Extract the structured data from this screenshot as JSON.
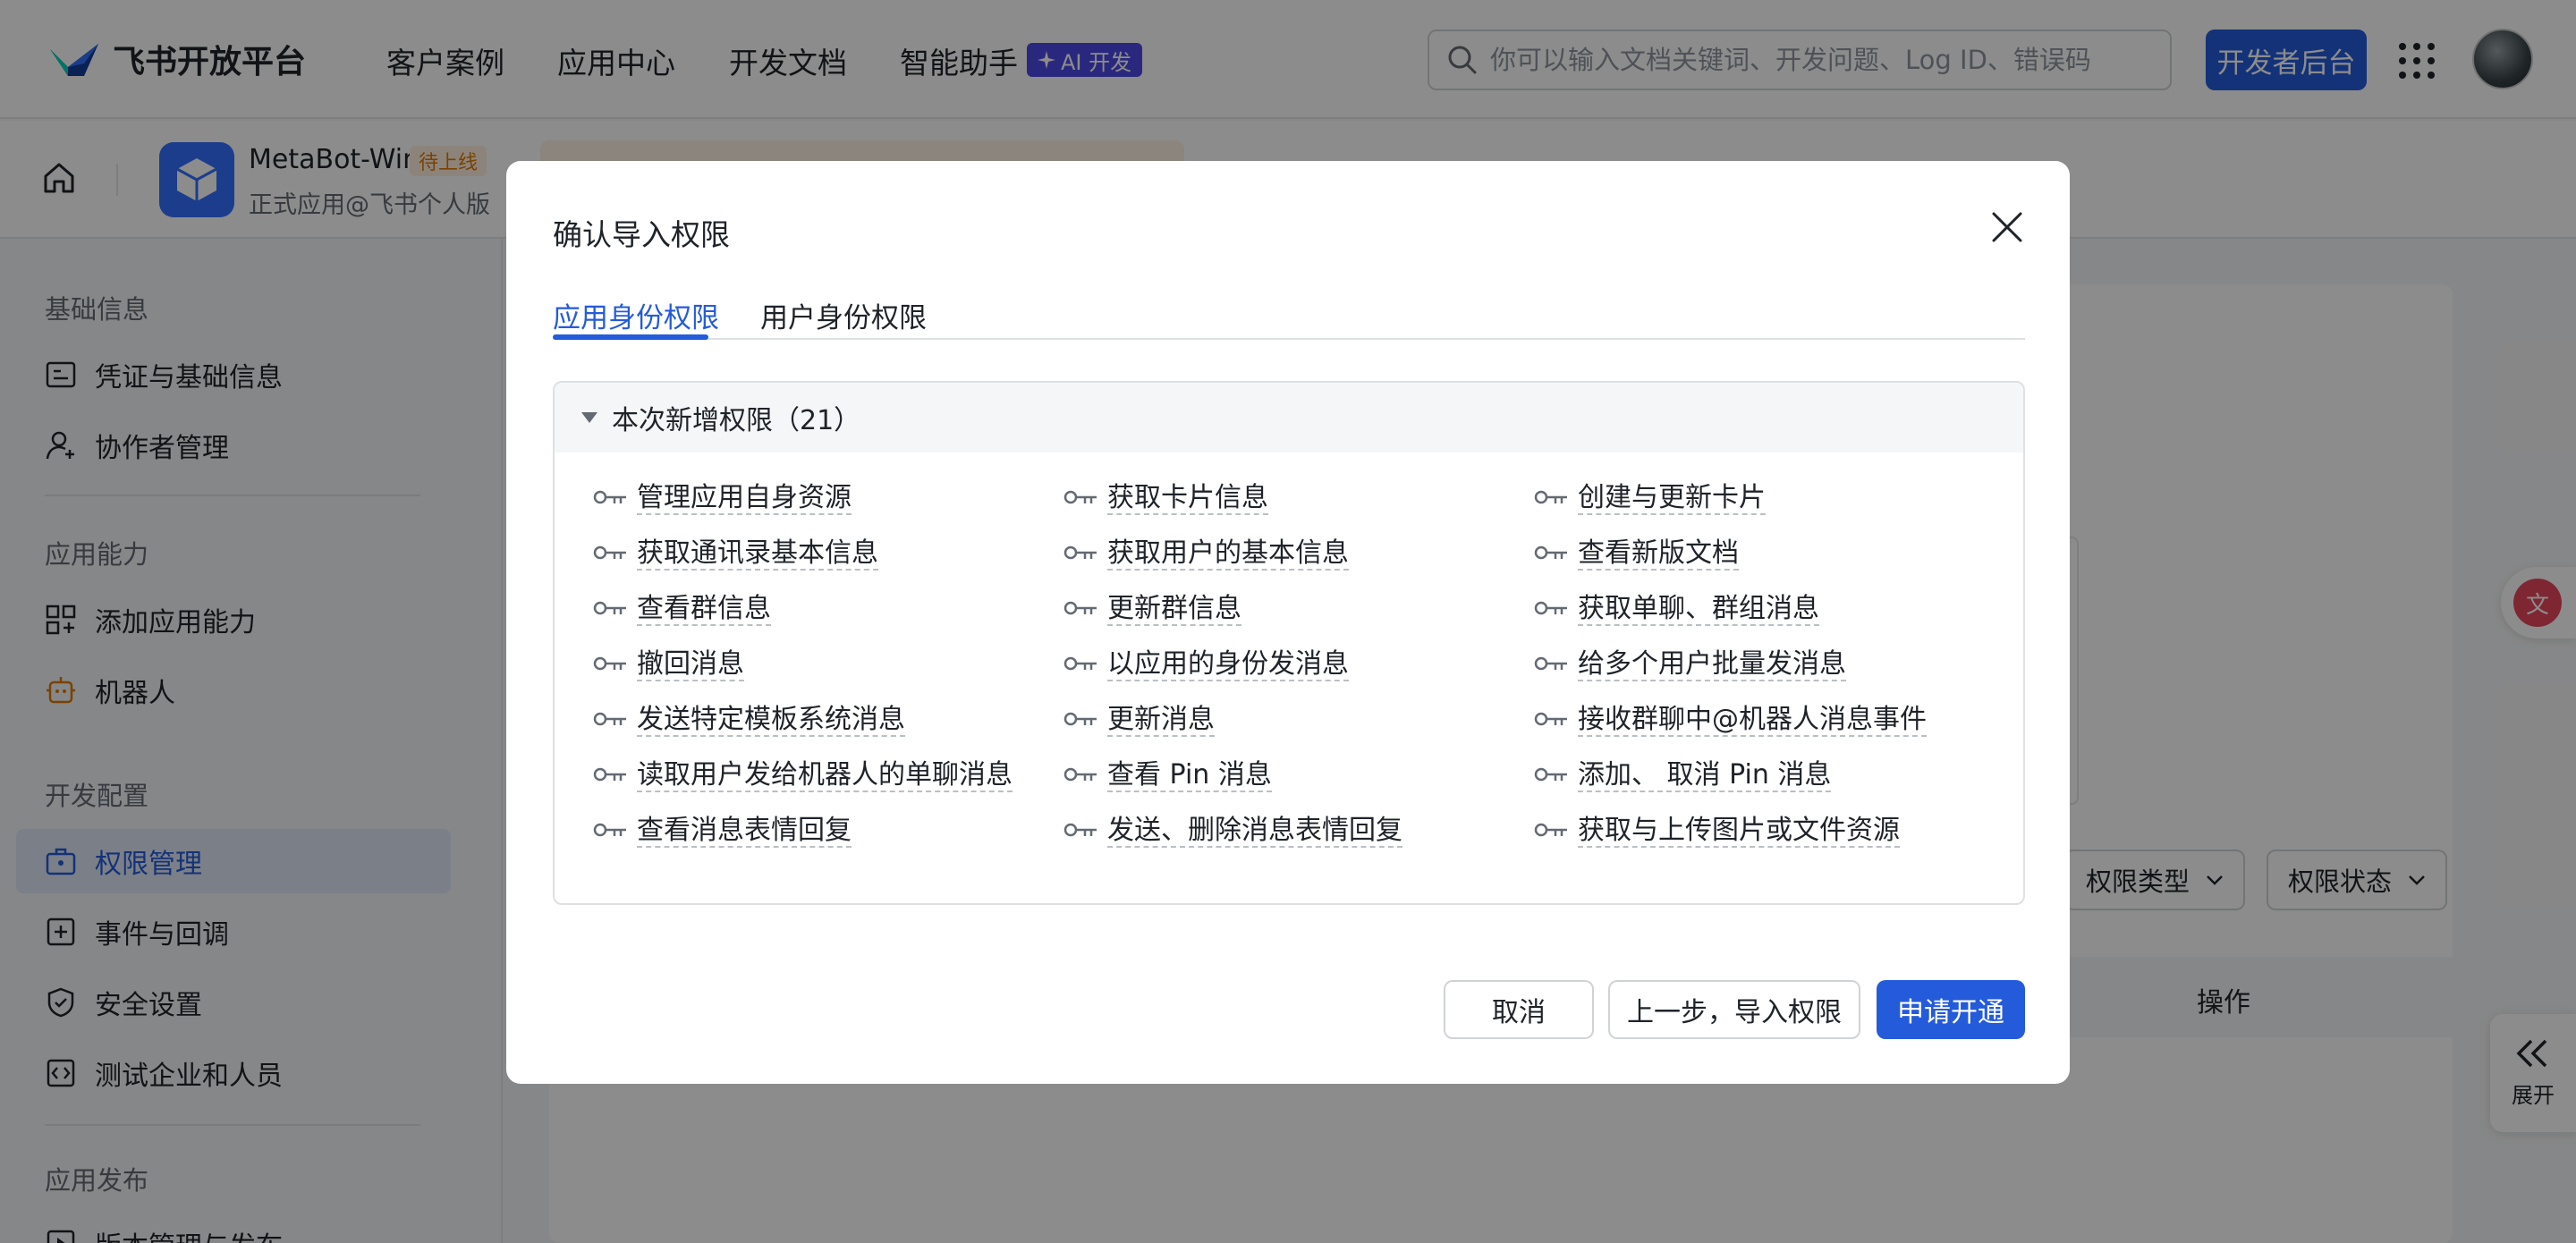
{
  "topnav": {
    "logo_text": "飞书开放平台",
    "nav": [
      "客户案例",
      "应用中心",
      "开发文档",
      "智能助手"
    ],
    "ai_badge": "AI 开发",
    "search_placeholder": "你可以输入文档关键词、开发问题、Log ID、错误码",
    "dev_console": "开发者后台"
  },
  "appbar": {
    "app_name": "MetaBot-Win",
    "app_tag": "待上线",
    "app_sub": "正式应用@飞书个人版"
  },
  "sidebar": {
    "sections": [
      {
        "title": "基础信息",
        "items": [
          "凭证与基础信息",
          "协作者管理"
        ]
      },
      {
        "title": "应用能力",
        "items": [
          "添加应用能力",
          "机器人"
        ]
      },
      {
        "title": "开发配置",
        "items": [
          "权限管理",
          "事件与回调",
          "安全设置",
          "测试企业和人员"
        ]
      },
      {
        "title": "应用发布",
        "items": [
          "版本管理与发布"
        ]
      }
    ],
    "active": "权限管理"
  },
  "background": {
    "filters": [
      "权限类型",
      "权限状态"
    ],
    "table_op": "操作",
    "expand_label": "展开"
  },
  "modal": {
    "title": "确认导入权限",
    "tabs": [
      "应用身份权限",
      "用户身份权限"
    ],
    "active_tab": 0,
    "section_title": "本次新增权限（21）",
    "permissions": [
      "管理应用自身资源",
      "获取卡片信息",
      "创建与更新卡片",
      "获取通讯录基本信息",
      "获取用户的基本信息",
      "查看新版文档",
      "查看群信息",
      "更新群信息",
      "获取单聊、群组消息",
      "撤回消息",
      "以应用的身份发消息",
      "给多个用户批量发消息",
      "发送特定模板系统消息",
      "更新消息",
      "接收群聊中@机器人消息事件",
      "读取用户发给机器人的单聊消息",
      "查看 Pin 消息",
      "添加、 取消 Pin 消息",
      "查看消息表情回复",
      "发送、删除消息表情回复",
      "获取与上传图片或文件资源"
    ],
    "buttons": {
      "cancel": "取消",
      "prev": "上一步，导入权限",
      "apply": "申请开通"
    }
  },
  "colors": {
    "primary": "#245bdb",
    "ai_badge": "#4e49e6",
    "tag_bg": "#fff1e1",
    "tag_text": "#de7802"
  }
}
